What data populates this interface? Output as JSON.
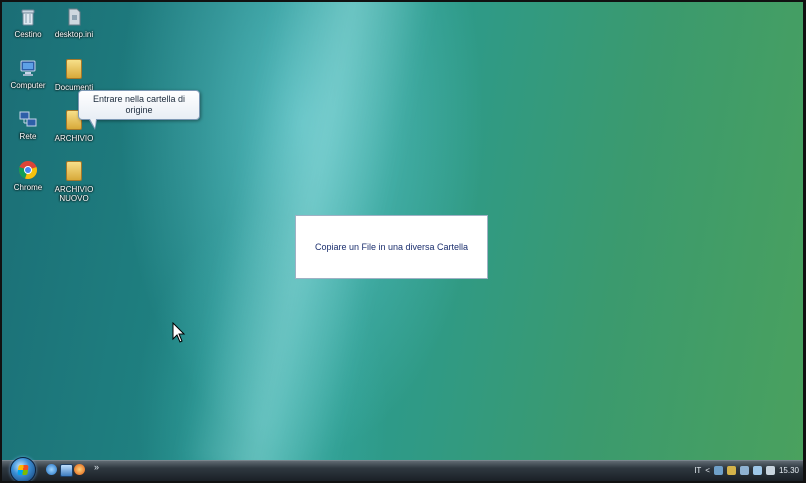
{
  "desktop": {
    "icons": [
      {
        "label": "Cestino",
        "icon": "recycle-bin-icon"
      },
      {
        "label": "desktop.ini",
        "icon": "file-icon"
      },
      {
        "label": "Computer",
        "icon": "computer-icon"
      },
      {
        "label": "Documenti",
        "icon": "folder-icon"
      },
      {
        "label": "Rete",
        "icon": "network-icon"
      },
      {
        "label": "ARCHIVIO",
        "icon": "folder-icon"
      },
      {
        "label": "Chrome",
        "icon": "chrome-icon"
      },
      {
        "label": "ARCHIVIO NUOVO",
        "icon": "folder-icon"
      }
    ]
  },
  "tooltip": {
    "text": "Entrare nella cartella di origine"
  },
  "caption": {
    "text": "Copiare un File in una diversa Cartella"
  },
  "taskbar": {
    "quicklaunch_chevron": "»",
    "language": "IT",
    "tray_chevron": "<",
    "clock": "15.30"
  },
  "colors": {
    "desktop_teal": "#1f8080",
    "desktop_green": "#4aa15e",
    "caption_text": "#1b2f6e"
  }
}
